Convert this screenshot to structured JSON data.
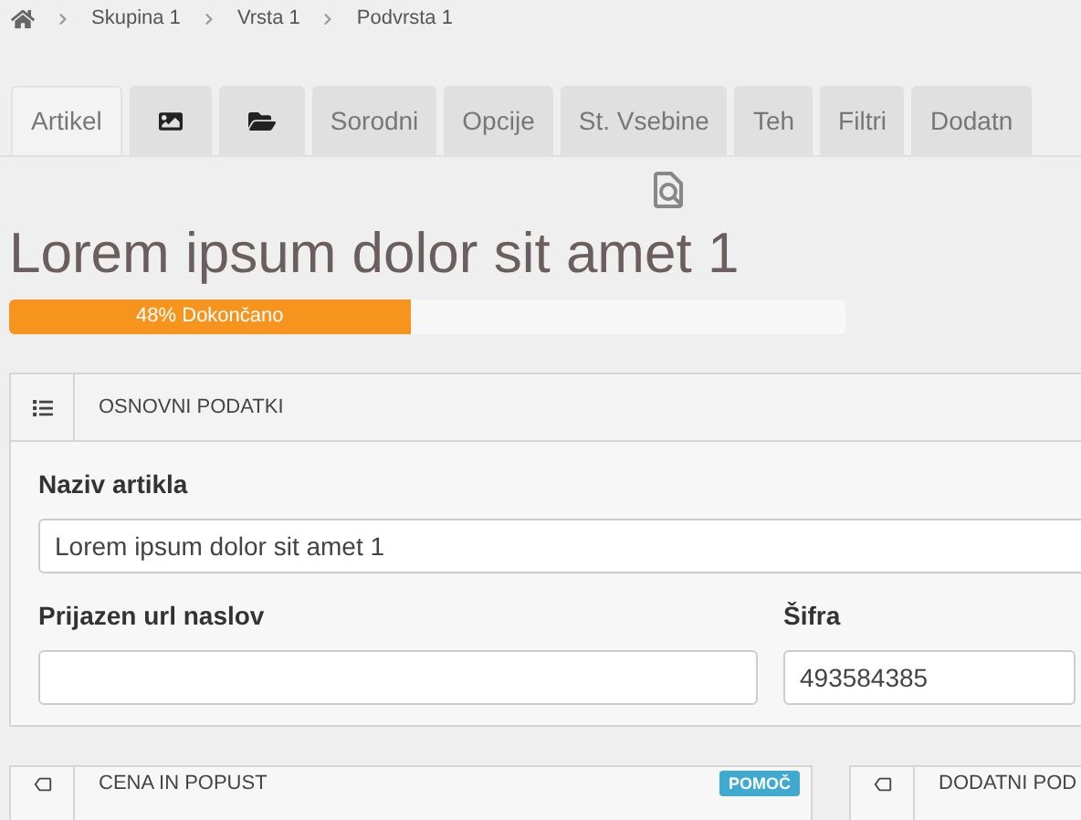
{
  "breadcrumb": [
    "Skupina 1",
    "Vrsta 1",
    "Podvrsta 1"
  ],
  "tabs": [
    {
      "kind": "text",
      "label": "Artikel",
      "selected": true
    },
    {
      "kind": "image",
      "selected": false
    },
    {
      "kind": "folder",
      "selected": false
    },
    {
      "kind": "text",
      "label": "Sorodni",
      "selected": false
    },
    {
      "kind": "text",
      "label": "Opcije",
      "selected": false
    },
    {
      "kind": "text",
      "label": "St. Vsebine",
      "selected": false
    },
    {
      "kind": "text",
      "label": "Teh",
      "selected": false
    },
    {
      "kind": "text",
      "label": "Filtri",
      "selected": false
    },
    {
      "kind": "text",
      "label": "Dodatn",
      "selected": false
    }
  ],
  "title": "Lorem ipsum dolor sit amet 1",
  "progress": {
    "label": "48% Dokončano",
    "level": 0.48
  },
  "panel": {
    "title": "OSNOVNI PODATKI",
    "fields": [
      {
        "label": "Naziv artikla",
        "value": "Lorem ipsum dolor sit amet 1"
      },
      {
        "label": "Prijazen url naslov"
      },
      {
        "label": "Šifra",
        "value": "493584385"
      }
    ]
  },
  "bottom_panels": [
    {
      "title": "CENA IN POPUST",
      "button": "POMOČ"
    },
    {
      "title": "DODATNI POD"
    }
  ]
}
